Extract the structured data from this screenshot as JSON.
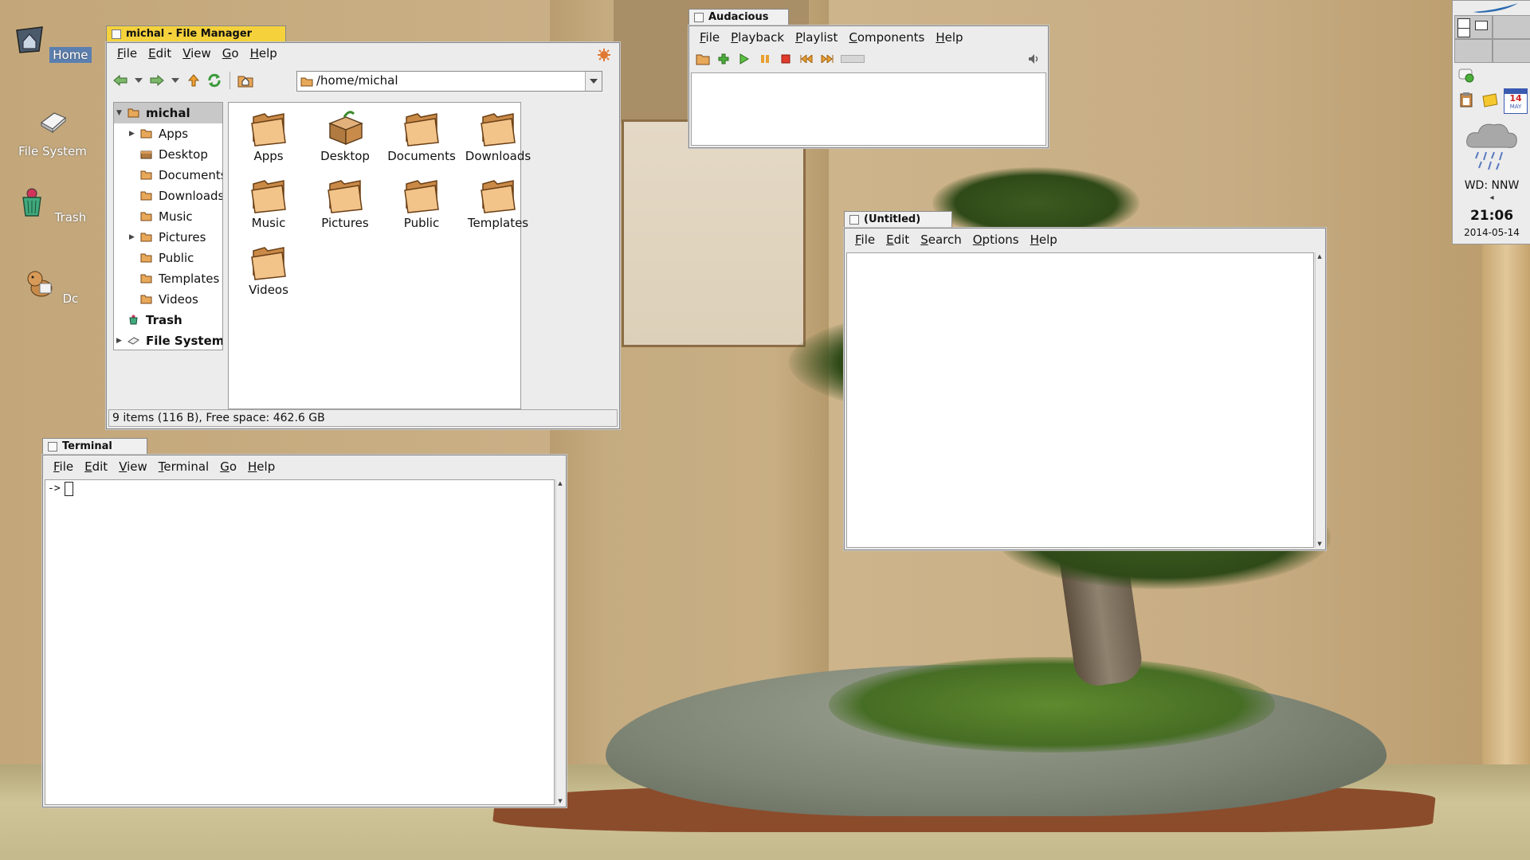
{
  "desktop": {
    "icons": [
      {
        "label": "Home",
        "icon": "home-icon"
      },
      {
        "label": "File System",
        "icon": "drive-icon"
      },
      {
        "label": "Trash",
        "icon": "trash-icon"
      },
      {
        "label": "Dc",
        "icon": "dog-icon"
      }
    ]
  },
  "file_manager": {
    "title": "michal - File Manager",
    "menu": [
      "File",
      "Edit",
      "View",
      "Go",
      "Help"
    ],
    "location": "/home/michal",
    "tree": [
      {
        "label": "michal",
        "bold": true,
        "expander": "open"
      },
      {
        "label": "Apps",
        "expander": "closed"
      },
      {
        "label": "Desktop"
      },
      {
        "label": "Documents"
      },
      {
        "label": "Downloads"
      },
      {
        "label": "Music"
      },
      {
        "label": "Pictures",
        "expander": "closed"
      },
      {
        "label": "Public"
      },
      {
        "label": "Templates"
      },
      {
        "label": "Videos"
      },
      {
        "label": "Trash",
        "bold": true
      },
      {
        "label": "File System",
        "bold": true,
        "expander": "closed"
      }
    ],
    "items": [
      "Apps",
      "Desktop",
      "Documents",
      "Downloads",
      "Music",
      "Pictures",
      "Public",
      "Templates",
      "Videos"
    ],
    "status": "9 items (116 B), Free space: 462.6 GB"
  },
  "audacious": {
    "title": "Audacious",
    "menu": [
      "File",
      "Playback",
      "Playlist",
      "Components",
      "Help"
    ]
  },
  "editor": {
    "title": "(Untitled)",
    "menu": [
      "File",
      "Edit",
      "Search",
      "Options",
      "Help"
    ]
  },
  "terminal": {
    "title": "Terminal",
    "menu": [
      "File",
      "Edit",
      "View",
      "Terminal",
      "Go",
      "Help"
    ],
    "prompt": "->"
  },
  "tray": {
    "weather": "WD: NNW",
    "weather_arrow": "◂",
    "time": "21:06",
    "date": "2014-05-14",
    "calendar_day": "14",
    "calendar_month": "MAY"
  },
  "colors": {
    "active_tab": "#f5d23c",
    "folder": "#e8a85a",
    "selection": "#c8c8c8"
  }
}
